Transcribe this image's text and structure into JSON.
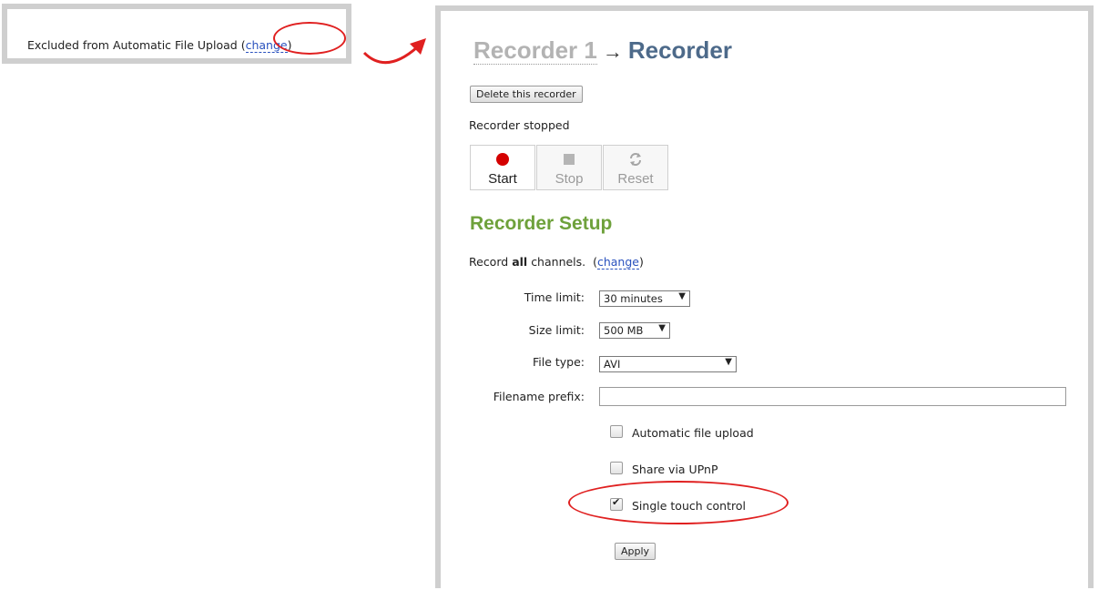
{
  "left_panel": {
    "text": "Excluded from Automatic File Upload",
    "open_paren": "(",
    "change_link": "change",
    "close_paren": ")"
  },
  "main": {
    "title_part1": "Recorder 1",
    "title_arrow": "→",
    "title_part2": "Recorder",
    "delete_button": "Delete this recorder",
    "status": "Recorder stopped",
    "controls": [
      {
        "label": "Start",
        "icon": "record-dot-icon",
        "state": "active"
      },
      {
        "label": "Stop",
        "icon": "stop-square-icon",
        "state": "disabled"
      },
      {
        "label": "Reset",
        "icon": "reset-icon",
        "state": "disabled"
      }
    ],
    "section_title": "Recorder Setup",
    "record_prefix": "Record",
    "record_bold": "all",
    "record_suffix": "channels.",
    "record_change": "change",
    "fields": {
      "time_limit_label": "Time limit:",
      "time_limit_value": "30 minutes",
      "size_limit_label": "Size limit:",
      "size_limit_value": "500 MB",
      "file_type_label": "File type:",
      "file_type_value": "AVI",
      "prefix_label": "Filename prefix:",
      "prefix_value": ""
    },
    "checkboxes": [
      {
        "label": "Automatic file upload",
        "checked": false
      },
      {
        "label": "Share via UPnP",
        "checked": false
      },
      {
        "label": "Single touch control",
        "checked": true
      }
    ],
    "apply_button": "Apply"
  },
  "colors": {
    "accent_green": "#6ea13b",
    "title_blue": "#4d6a8a",
    "annotation_red": "#e02020",
    "link_blue": "#2a52be"
  }
}
